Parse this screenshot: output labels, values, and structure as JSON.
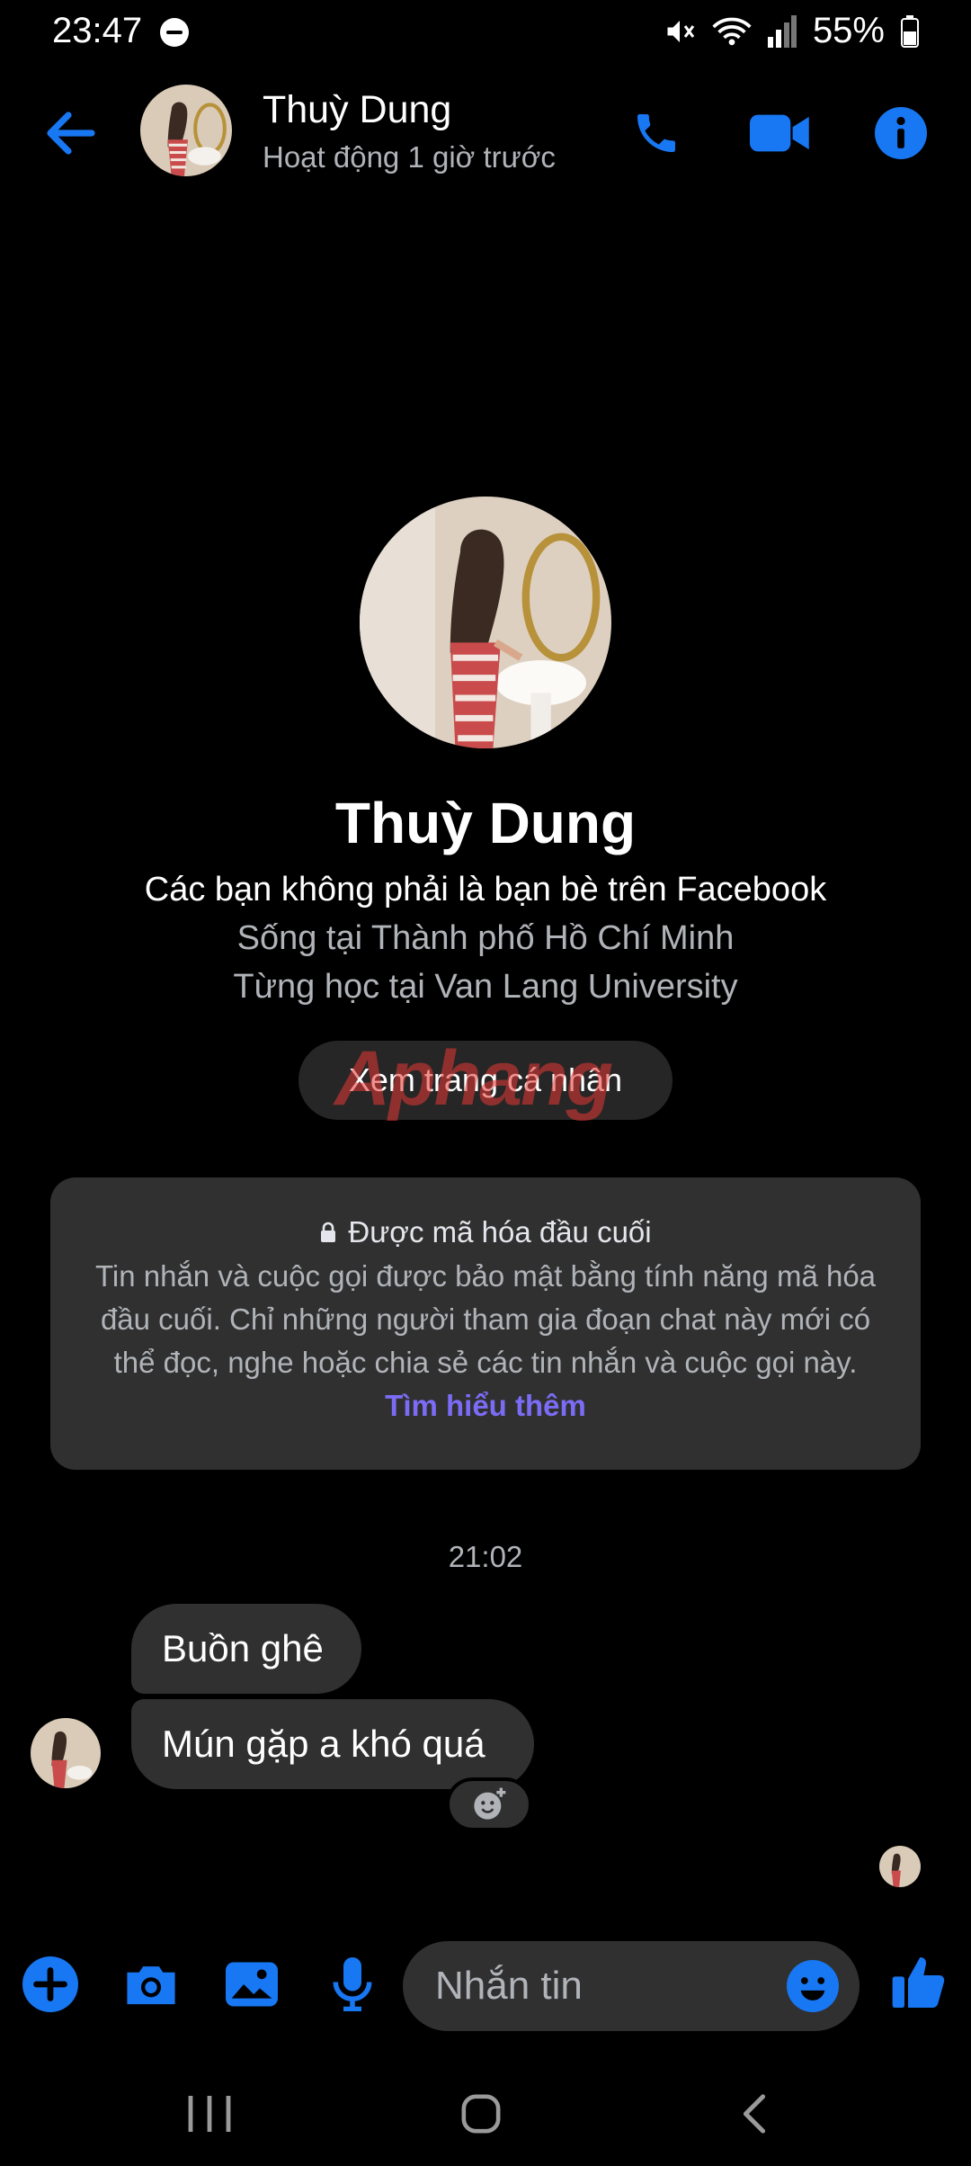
{
  "status_bar": {
    "time": "23:47",
    "battery": "55%",
    "icons": [
      "dnd-icon",
      "mute-icon",
      "wifi-icon",
      "signal-icon",
      "battery-icon"
    ]
  },
  "header": {
    "name": "Thuỳ Dung",
    "activity": "Hoạt động 1 giờ trước",
    "icons": [
      "back-arrow-icon",
      "phone-icon",
      "video-camera-icon",
      "info-icon"
    ]
  },
  "profile": {
    "name": "Thuỳ Dung",
    "friend_status": "Các bạn không phải là bạn bè trên Facebook",
    "lives_in": "Sống tại Thành phố Hồ Chí Minh",
    "studied_at": "Từng học tại Van Lang University",
    "view_profile_label": "Xem trang cá nhân",
    "watermark": "Aphang"
  },
  "e2ee": {
    "title": "Được mã hóa đầu cuối",
    "body": "Tin nhắn và cuộc gọi được bảo mật bằng tính năng mã hóa đầu cuối. Chỉ những người tham gia đoạn chat này mới có thể đọc, nghe hoặc chia sẻ các tin nhắn và cuộc gọi này.",
    "link": "Tìm hiểu thêm"
  },
  "conversation": {
    "timestamp": "21:02",
    "messages": [
      {
        "text": "Buồn ghê"
      },
      {
        "text": "Mún gặp a khó quá"
      }
    ]
  },
  "composer": {
    "placeholder": "Nhắn tin",
    "icons": [
      "plus-icon",
      "camera-icon",
      "image-icon",
      "microphone-icon",
      "emoji-icon",
      "thumbs-up-icon"
    ]
  },
  "colors": {
    "accent": "#1877f2",
    "link": "#7b6cf6",
    "bubble": "#303030",
    "background": "#000000"
  }
}
